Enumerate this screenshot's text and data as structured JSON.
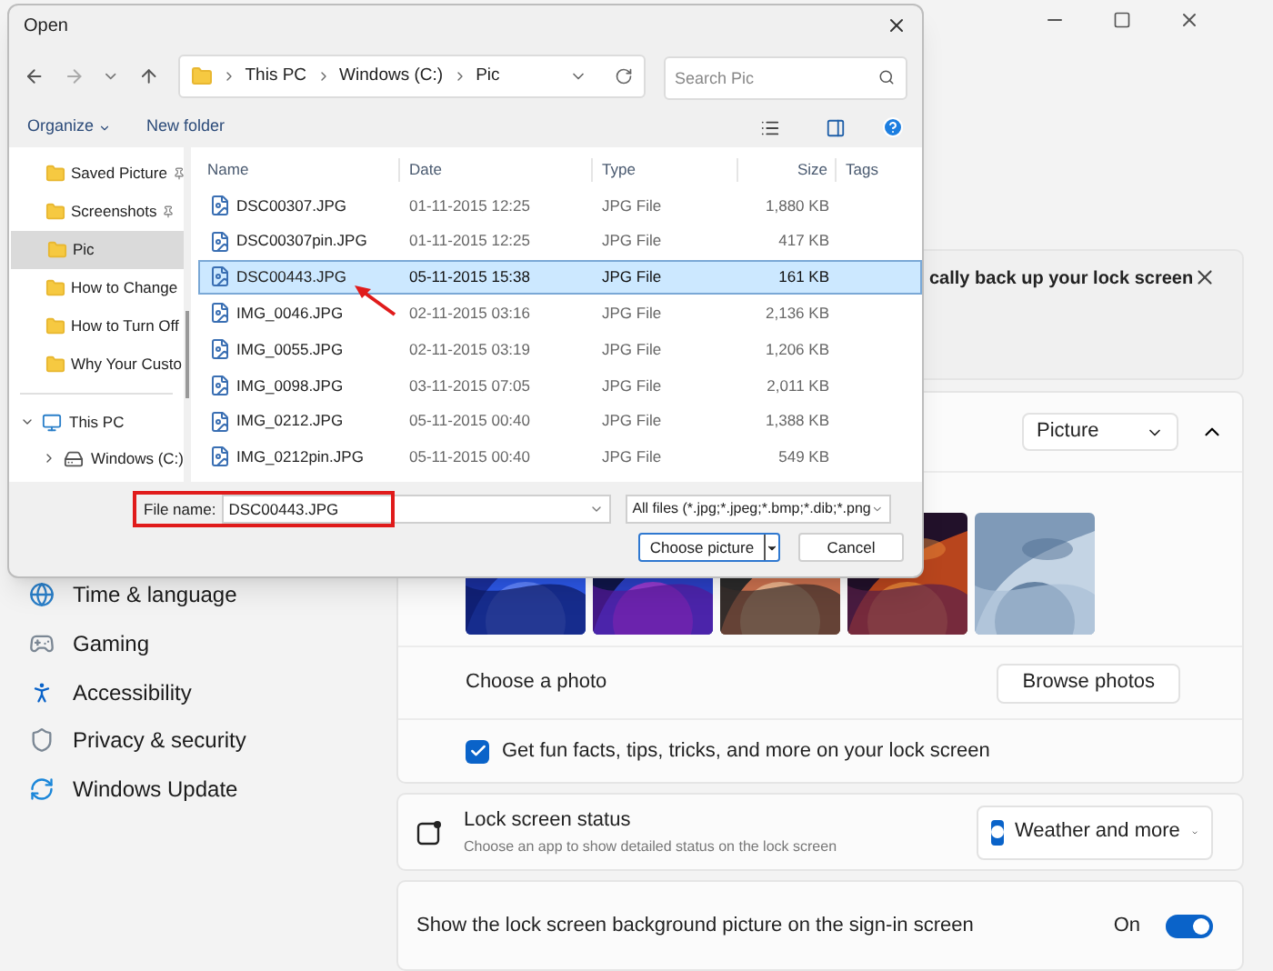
{
  "settings": {
    "sidebar": [
      {
        "label": "Time & language"
      },
      {
        "label": "Gaming"
      },
      {
        "label": "Accessibility"
      },
      {
        "label": "Privacy & security"
      },
      {
        "label": "Windows Update"
      }
    ],
    "banner": {
      "text": "cally back up your lock screen"
    },
    "personalize": {
      "dropdown": "Picture",
      "expanded": true
    },
    "choose_photo": {
      "label": "Choose a photo",
      "button": "Browse photos"
    },
    "fun_facts": {
      "label": "Get fun facts, tips, tricks, and more on your lock screen",
      "checked": true
    },
    "lock_status": {
      "title": "Lock screen status",
      "subtitle": "Choose an app to show detailed status on the lock screen",
      "dropdown": "Weather and more"
    },
    "signin": {
      "label": "Show the lock screen background picture on the sign-in screen",
      "state": "On",
      "on": true
    }
  },
  "dialog": {
    "title": "Open",
    "breadcrumb": [
      "This PC",
      "Windows (C:)",
      "Pic"
    ],
    "search": {
      "placeholder": "Search Pic"
    },
    "toolbar": [
      "Organize",
      "New folder"
    ],
    "nav_pane": [
      {
        "label": "Saved Picture",
        "pinned": true,
        "selected": false
      },
      {
        "label": "Screenshots",
        "pinned": true,
        "selected": false
      },
      {
        "label": "Pic",
        "pinned": false,
        "selected": true
      },
      {
        "label": "How to Change",
        "pinned": false,
        "selected": false
      },
      {
        "label": "How to Turn Off",
        "pinned": false,
        "selected": false
      },
      {
        "label": "Why Your Custo",
        "pinned": false,
        "selected": false
      }
    ],
    "tree": [
      {
        "label": "This PC",
        "expanded": true
      },
      {
        "label": "Windows (C:)",
        "expanded": false
      }
    ],
    "columns": [
      "Name",
      "Date",
      "Type",
      "Size",
      "Tags"
    ],
    "rows": [
      {
        "name": "DSC00307.JPG",
        "date": "01-11-2015 12:25",
        "type": "JPG File",
        "size": "1,880 KB",
        "selected": false
      },
      {
        "name": "DSC00307pin.JPG",
        "date": "01-11-2015 12:25",
        "type": "JPG File",
        "size": "417 KB",
        "selected": false
      },
      {
        "name": "DSC00443.JPG",
        "date": "05-11-2015 15:38",
        "type": "JPG File",
        "size": "161 KB",
        "selected": true
      },
      {
        "name": "IMG_0046.JPG",
        "date": "02-11-2015 03:16",
        "type": "JPG File",
        "size": "2,136 KB",
        "selected": false
      },
      {
        "name": "IMG_0055.JPG",
        "date": "02-11-2015 03:19",
        "type": "JPG File",
        "size": "1,206 KB",
        "selected": false
      },
      {
        "name": "IMG_0098.JPG",
        "date": "03-11-2015 07:05",
        "type": "JPG File",
        "size": "2,011 KB",
        "selected": false
      },
      {
        "name": "IMG_0212.JPG",
        "date": "05-11-2015 00:40",
        "type": "JPG File",
        "size": "1,388 KB",
        "selected": false
      },
      {
        "name": "IMG_0212pin.JPG",
        "date": "05-11-2015 00:40",
        "type": "JPG File",
        "size": "549 KB",
        "selected": false
      }
    ],
    "file_name": {
      "label": "File name:",
      "value": "DSC00443.JPG"
    },
    "filter": "All files (*.jpg;*.jpeg;*.bmp;*.dib;*.png",
    "buttons": [
      "Choose picture",
      "Cancel"
    ]
  }
}
